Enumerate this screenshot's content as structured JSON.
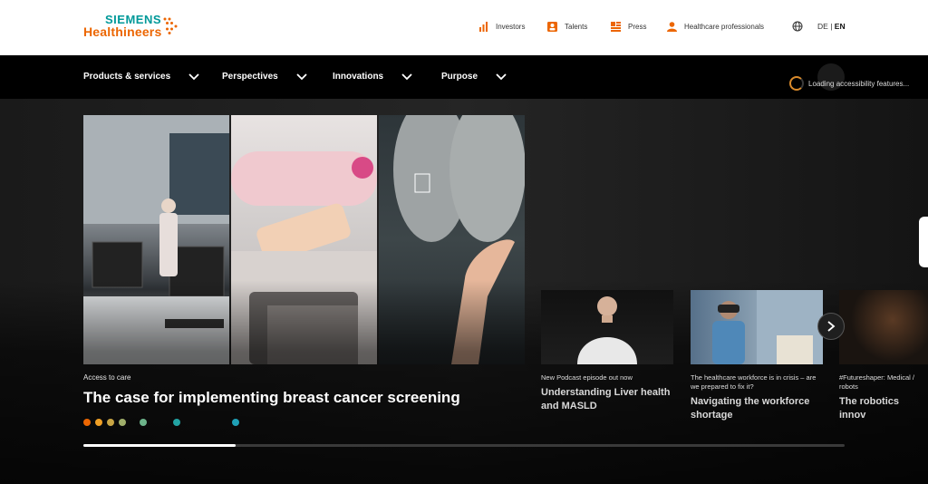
{
  "brand": {
    "name_line1": "SIEMENS",
    "name_line2": "Healthineers",
    "color_teal": "#009999",
    "color_orange": "#ec6602"
  },
  "utility_nav": [
    {
      "label": "Investors",
      "icon": "bar-chart-icon"
    },
    {
      "label": "Talents",
      "icon": "person-badge-icon"
    },
    {
      "label": "Press",
      "icon": "newspaper-icon"
    },
    {
      "label": "Healthcare professionals",
      "icon": "person-icon"
    }
  ],
  "language": {
    "de": "DE",
    "separator": "|",
    "en": "EN",
    "icon": "globe-icon"
  },
  "main_nav": [
    {
      "label": "Products & services"
    },
    {
      "label": "Perspectives"
    },
    {
      "label": "Innovations"
    },
    {
      "label": "Purpose"
    }
  ],
  "accessibility": {
    "status": "Loading accessibility features..."
  },
  "hero": {
    "kicker": "Access to care",
    "title": "The case for implementing breast cancer screening",
    "dots_colors": [
      "#ec6602",
      "#f0a026",
      "#c9a544",
      "#9fae6a",
      "#6db38a",
      "#22a3a3",
      "#1fa0b6"
    ],
    "progress_fraction": 0.2
  },
  "cards": [
    {
      "kicker": "New Podcast episode out now",
      "title": "Understanding Liver health and MASLD"
    },
    {
      "kicker": "The healthcare workforce is in crisis – are we prepared to fix it?",
      "title": "Navigating the workforce shortage"
    },
    {
      "kicker": "#Futureshaper: Medical / robots",
      "title": "The robotics innov"
    }
  ]
}
